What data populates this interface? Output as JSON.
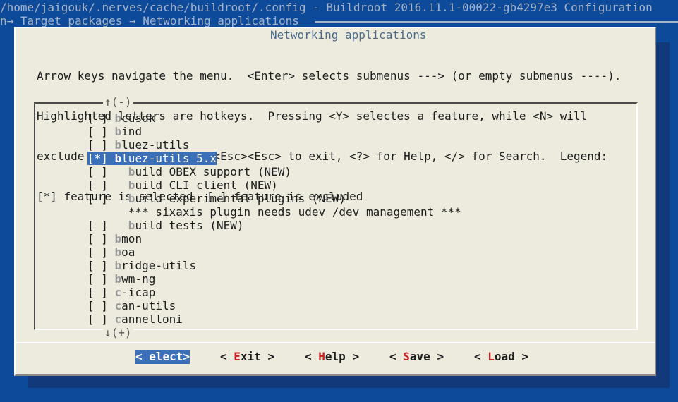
{
  "window_title": "/home/jaigouk/.nerves/cache/buildroot/.config - Buildroot 2016.11.1-00022-gb4297e3 Configuration",
  "breadcrumb": "n→ Target packages → Networking applications",
  "dialog": {
    "title": "Networking applications",
    "help_lines": [
      "Arrow keys navigate the menu.  <Enter> selects submenus ---> (or empty submenus ----).",
      "Highlighted letters are hotkeys.  Pressing <Y> selectes a feature, while <N> will",
      "exclude a feature.  Press <Esc><Esc> to exit, <?> for Help, </> for Search.  Legend:",
      "[*] feature is selected  [ ] feature is excluded"
    ],
    "scroll_up": "↑(-)",
    "scroll_down": "↓(+)"
  },
  "menu": [
    {
      "mark": "[ ]",
      "indent": "",
      "hotkey": "b",
      "rest": "cusdk",
      "selected": false
    },
    {
      "mark": "[ ]",
      "indent": "",
      "hotkey": "b",
      "rest": "ind",
      "selected": false
    },
    {
      "mark": "[ ]",
      "indent": "",
      "hotkey": "b",
      "rest": "luez-utils",
      "selected": false
    },
    {
      "mark": "[*]",
      "indent": "",
      "hotkey": "b",
      "rest": "luez-utils 5.x",
      "selected": true
    },
    {
      "mark": "[ ]",
      "indent": "  ",
      "hotkey": "b",
      "rest": "uild OBEX support (NEW)",
      "selected": false
    },
    {
      "mark": "[ ]",
      "indent": "  ",
      "hotkey": "b",
      "rest": "uild CLI client (NEW)",
      "selected": false
    },
    {
      "mark": "[ ]",
      "indent": "  ",
      "hotkey": "b",
      "rest": "uild experimental plugins (NEW)",
      "selected": false
    },
    {
      "mark": "   ",
      "indent": "  ",
      "hotkey": "",
      "rest": "*** sixaxis plugin needs udev /dev management ***",
      "selected": false
    },
    {
      "mark": "[ ]",
      "indent": "  ",
      "hotkey": "b",
      "rest": "uild tests (NEW)",
      "selected": false
    },
    {
      "mark": "[ ]",
      "indent": "",
      "hotkey": "b",
      "rest": "mon",
      "selected": false
    },
    {
      "mark": "[ ]",
      "indent": "",
      "hotkey": "b",
      "rest": "oa",
      "selected": false
    },
    {
      "mark": "[ ]",
      "indent": "",
      "hotkey": "b",
      "rest": "ridge-utils",
      "selected": false
    },
    {
      "mark": "[ ]",
      "indent": "",
      "hotkey": "b",
      "rest": "wm-ng",
      "selected": false
    },
    {
      "mark": "[ ]",
      "indent": "",
      "hotkey": "c",
      "rest": "-icap",
      "selected": false
    },
    {
      "mark": "[ ]",
      "indent": "",
      "hotkey": "c",
      "rest": "an-utils",
      "selected": false
    },
    {
      "mark": "[ ]",
      "indent": "",
      "hotkey": "c",
      "rest": "annelloni",
      "selected": false
    }
  ],
  "buttons": [
    {
      "pre": "< ",
      "key": "",
      "post": "elect>",
      "active": true
    },
    {
      "pre": "< ",
      "key": "E",
      "post": "xit >",
      "active": false
    },
    {
      "pre": "< ",
      "key": "H",
      "post": "elp >",
      "active": false
    },
    {
      "pre": "< ",
      "key": "S",
      "post": "ave >",
      "active": false
    },
    {
      "pre": "< ",
      "key": "L",
      "post": "oad >",
      "active": false
    }
  ],
  "colors": {
    "background": "#0e4a9a",
    "dialog": "#ecebde",
    "highlight": "#3b6fb8",
    "hotkey": "#c82020"
  }
}
